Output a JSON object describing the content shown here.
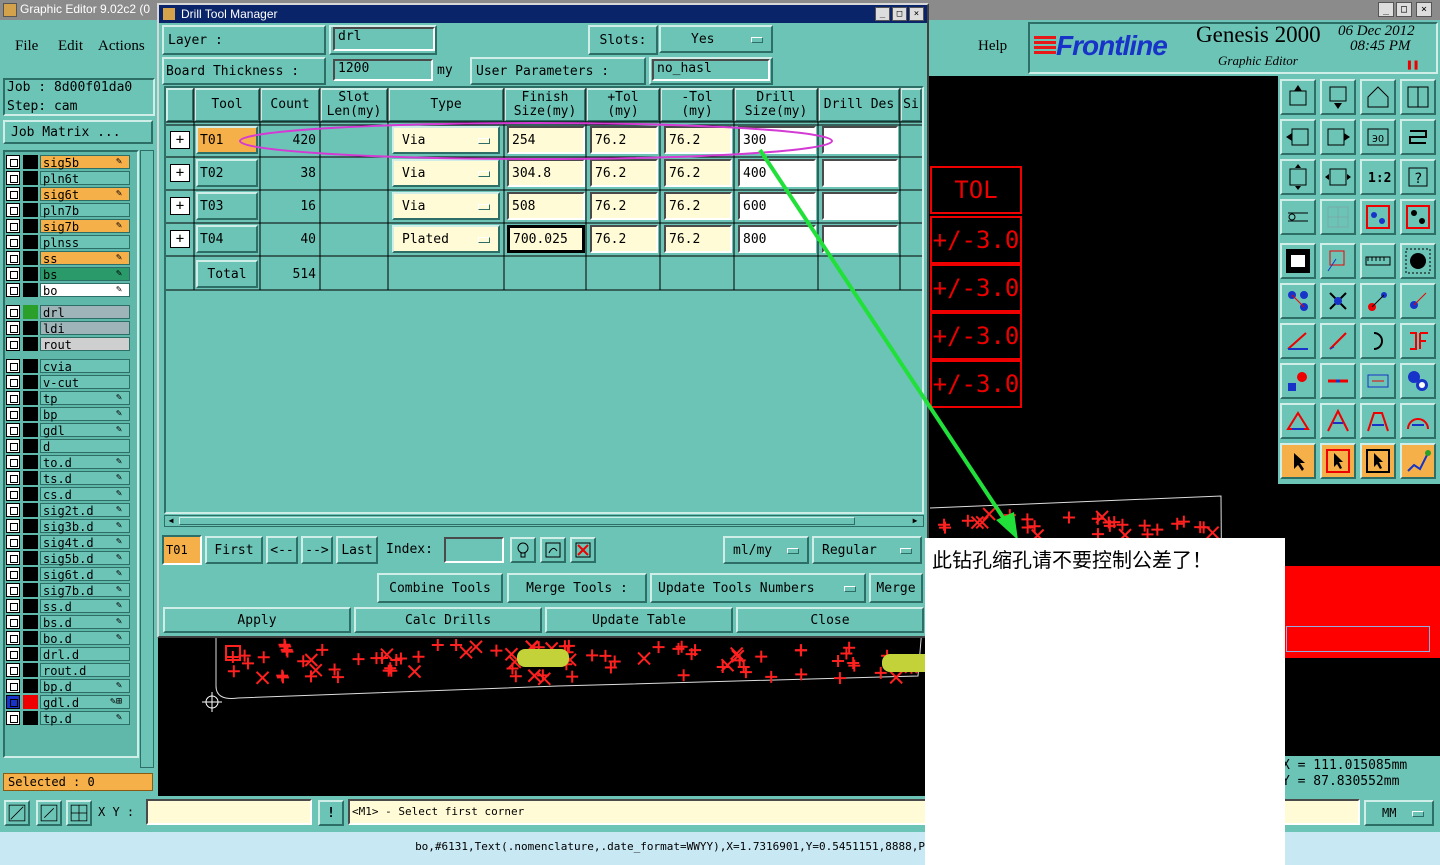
{
  "main_window": {
    "title": "Graphic Editor 9.02c2 (0"
  },
  "menu": {
    "file": "File",
    "edit": "Edit",
    "actions": "Actions",
    "help": "Help"
  },
  "job": {
    "job": "Job : 8d00f01da0",
    "step": "Step: cam",
    "matrix_button": "Job Matrix ..."
  },
  "layers": [
    {
      "name": "sig5b",
      "color": "#f6b04a",
      "icon": "✎"
    },
    {
      "name": "pln6t",
      "color": "#6cc4b6",
      "icon": ""
    },
    {
      "name": "sig6t",
      "color": "#f6b04a",
      "icon": "✎"
    },
    {
      "name": "pln7b",
      "color": "#6cc4b6",
      "icon": ""
    },
    {
      "name": "sig7b",
      "color": "#f6b04a",
      "icon": "✎"
    },
    {
      "name": "plnss",
      "color": "#6cc4b6",
      "icon": ""
    },
    {
      "name": "ss",
      "color": "#f6b04a",
      "icon": "✎"
    },
    {
      "name": "bs",
      "color": "#2b9a6a",
      "icon": "✎"
    },
    {
      "name": "bo",
      "color": "#ffffff",
      "icon": "✎"
    },
    {
      "name": "drl",
      "color": "#9fb4b8",
      "icon": ""
    },
    {
      "name": "ldi",
      "color": "#9fb4b8",
      "icon": ""
    },
    {
      "name": "rout",
      "color": "#cfcfcf",
      "icon": ""
    },
    {
      "name": "cvia",
      "color": "#6cc4b6",
      "icon": ""
    },
    {
      "name": "v-cut",
      "color": "#6cc4b6",
      "icon": ""
    },
    {
      "name": "tp",
      "color": "#6cc4b6",
      "icon": "✎"
    },
    {
      "name": "bp",
      "color": "#6cc4b6",
      "icon": "✎"
    },
    {
      "name": "gdl",
      "color": "#6cc4b6",
      "icon": "✎"
    },
    {
      "name": "d",
      "color": "#6cc4b6",
      "icon": ""
    },
    {
      "name": "to.d",
      "color": "#6cc4b6",
      "icon": "✎"
    },
    {
      "name": "ts.d",
      "color": "#6cc4b6",
      "icon": "✎"
    },
    {
      "name": "cs.d",
      "color": "#6cc4b6",
      "icon": "✎"
    },
    {
      "name": "sig2t.d",
      "color": "#6cc4b6",
      "icon": "✎"
    },
    {
      "name": "sig3b.d",
      "color": "#6cc4b6",
      "icon": "✎"
    },
    {
      "name": "sig4t.d",
      "color": "#6cc4b6",
      "icon": "✎"
    },
    {
      "name": "sig5b.d",
      "color": "#6cc4b6",
      "icon": "✎"
    },
    {
      "name": "sig6t.d",
      "color": "#6cc4b6",
      "icon": "✎"
    },
    {
      "name": "sig7b.d",
      "color": "#6cc4b6",
      "icon": "✎"
    },
    {
      "name": "ss.d",
      "color": "#6cc4b6",
      "icon": "✎"
    },
    {
      "name": "bs.d",
      "color": "#6cc4b6",
      "icon": "✎"
    },
    {
      "name": "bo.d",
      "color": "#6cc4b6",
      "icon": "✎"
    },
    {
      "name": "drl.d",
      "color": "#6cc4b6",
      "icon": ""
    },
    {
      "name": "rout.d",
      "color": "#6cc4b6",
      "icon": ""
    },
    {
      "name": "bp.d",
      "color": "#6cc4b6",
      "icon": "✎"
    },
    {
      "name": "gdl.d",
      "color": "#6cc4b6",
      "icon": "✎⊞"
    },
    {
      "name": "tp.d",
      "color": "#6cc4b6",
      "icon": "✎"
    }
  ],
  "selected": "Selected : 0",
  "brand": {
    "logo": "Frontline",
    "product": "Genesis 2000",
    "subtitle": "Graphic Editor",
    "date": "06 Dec 2012",
    "time": "08:45 PM"
  },
  "coords": {
    "x": "X = 111.015085mm",
    "y": "Y = 87.830552mm"
  },
  "statusbar": {
    "xy_label": "X Y :",
    "message": "<M1> - Select first corner",
    "units": "MM",
    "bottom_text": "bo,#6131,Text(.nomenclature,.date_format=WWYY),X=1.7316901,Y=0.5451151,8888,P"
  },
  "tolerance_labels": {
    "header": "TOL",
    "values": [
      "+/-3.0",
      "+/-3.0",
      "+/-3.0",
      "+/-3.0"
    ]
  },
  "annotation": {
    "text": "此钻孔缩孔请不要控制公差了！"
  },
  "dialog": {
    "title": "Drill Tool Manager",
    "layer_label": "Layer :",
    "layer_value": "drl",
    "slots_label": "Slots:",
    "slots_value": "Yes",
    "thickness_label": "Board Thickness :",
    "thickness_value": "1200",
    "thickness_unit": "my",
    "user_params_label": "User Parameters :",
    "user_params_value": "no_hasl",
    "headers": [
      "Tool",
      "Count",
      "Slot Len(my)",
      "Type",
      "Finish Size(my)",
      "+Tol (my)",
      "-Tol (my)",
      "Drill Size(my)",
      "Drill Des",
      "Si"
    ],
    "rows": [
      {
        "tool": "T01",
        "count": "420",
        "type": "Via",
        "finish": "254",
        "ptol": "76.2",
        "mtol": "76.2",
        "drill": "300"
      },
      {
        "tool": "T02",
        "count": "38",
        "type": "Via",
        "finish": "304.8",
        "ptol": "76.2",
        "mtol": "76.2",
        "drill": "400"
      },
      {
        "tool": "T03",
        "count": "16",
        "type": "Via",
        "finish": "508",
        "ptol": "76.2",
        "mtol": "76.2",
        "drill": "600"
      },
      {
        "tool": "T04",
        "count": "40",
        "type": "Plated",
        "finish": "700.025",
        "ptol": "76.2",
        "mtol": "76.2",
        "drill": "800"
      }
    ],
    "total_label": "Total",
    "total_count": "514",
    "nav": {
      "current": "T01",
      "first": "First",
      "prev": "<--",
      "next": "-->",
      "last": "Last",
      "index_label": "Index:",
      "units": "ml/my",
      "mode": "Regular"
    },
    "tools_row": {
      "combine": "Combine Tools",
      "merge_label": "Merge Tools :",
      "update_numbers": "Update Tools Numbers",
      "merge": "Merge"
    },
    "actions": {
      "apply": "Apply",
      "calc": "Calc Drills",
      "update": "Update Table",
      "close": "Close"
    }
  },
  "colors": {
    "panel": "#6cc4b6",
    "accent": "#f6b04a",
    "canvas": "#000000",
    "pad": "#ff0000",
    "arrow": "#22e03a",
    "highlight": "#d43ad4"
  }
}
